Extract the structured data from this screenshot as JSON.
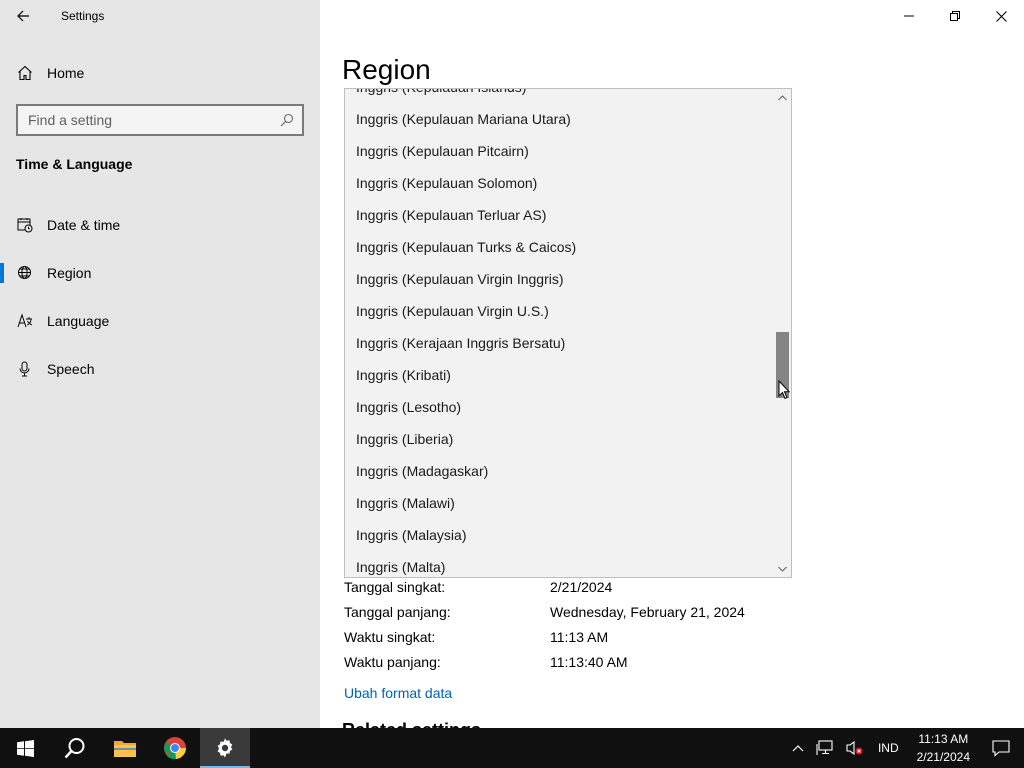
{
  "window": {
    "title": "Settings"
  },
  "sidebar": {
    "home_label": "Home",
    "search_placeholder": "Find a setting",
    "section_title": "Time & Language",
    "items": [
      {
        "label": "Date & time",
        "icon": "calendar-clock-icon",
        "active": false
      },
      {
        "label": "Region",
        "icon": "globe-icon",
        "active": true
      },
      {
        "label": "Language",
        "icon": "language-icon",
        "active": false
      },
      {
        "label": "Speech",
        "icon": "microphone-icon",
        "active": false
      }
    ]
  },
  "main": {
    "page_title": "Region",
    "formats": [
      {
        "key": "Tanggal singkat:",
        "value": "2/21/2024"
      },
      {
        "key": "Tanggal panjang:",
        "value": "Wednesday, February 21, 2024"
      },
      {
        "key": "Waktu singkat:",
        "value": "11:13 AM"
      },
      {
        "key": "Waktu panjang:",
        "value": "11:13:40 AM"
      }
    ],
    "change_format_link": "Ubah format data",
    "related_settings": "Related settings"
  },
  "dropdown": {
    "items": [
      "Inggris (Kepulauan Islands)",
      "Inggris (Kepulauan Mariana Utara)",
      "Inggris (Kepulauan Pitcairn)",
      "Inggris (Kepulauan Solomon)",
      "Inggris (Kepulauan Terluar AS)",
      "Inggris (Kepulauan Turks & Caicos)",
      "Inggris (Kepulauan Virgin Inggris)",
      "Inggris (Kepulauan Virgin U.S.)",
      "Inggris (Kerajaan Inggris Bersatu)",
      "Inggris (Kribati)",
      "Inggris (Lesotho)",
      "Inggris (Liberia)",
      "Inggris (Madagaskar)",
      "Inggris (Malawi)",
      "Inggris (Malaysia)",
      "Inggris (Malta)"
    ]
  },
  "taskbar": {
    "lang": "IND",
    "time": "11:13 AM",
    "date": "2/21/2024"
  },
  "colors": {
    "accent": "#0078d7",
    "link": "#0063b1",
    "sidebar_bg": "#e6e6e6",
    "taskbar_bg": "#101010"
  }
}
